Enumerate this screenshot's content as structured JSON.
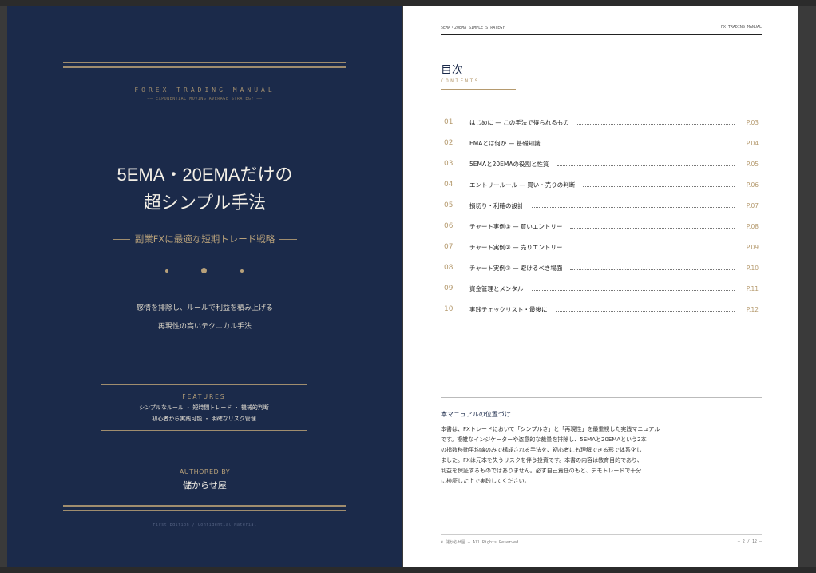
{
  "cover": {
    "kicker": "FOREX TRADING MANUAL",
    "kicker_sub": "—— EXPONENTIAL MOVING AVERAGE STRATEGY ——",
    "title_line1": "5EMA・20EMAだけの",
    "title_line2": "超シンプル手法",
    "tagline": "副業FXに最適な短期トレード戦略",
    "desc_line1": "感情を排除し、ルールで利益を積み上げる",
    "desc_line2": "再現性の高いテクニカル手法",
    "features": {
      "heading": "FEATURES",
      "line1": "シンプルなルール ・ 短時間トレード ・ 機械的判断",
      "line2": "初心者から実践可能 ・ 明確なリスク管理"
    },
    "authored_by": "AUTHORED BY",
    "author": "儲からせ屋",
    "footer": "First Edition  /  Confidential Material"
  },
  "toc_page": {
    "running_head_left": "5EMA・20EMA SIMPLE STRATEGY",
    "running_head_right": "FX TRADING MANUAL",
    "title": "目次",
    "subtitle": "CONTENTS",
    "items": [
      {
        "num": "01",
        "text": "はじめに — この手法で得られるもの",
        "page": "P.03"
      },
      {
        "num": "02",
        "text": "EMAとは何か — 基礎知識",
        "page": "P.04"
      },
      {
        "num": "03",
        "text": "5EMAと20EMAの役割と性質",
        "page": "P.05"
      },
      {
        "num": "04",
        "text": "エントリールール — 買い・売りの判断",
        "page": "P.06"
      },
      {
        "num": "05",
        "text": "損切り・利確の設計",
        "page": "P.07"
      },
      {
        "num": "06",
        "text": "チャート実例① — 買いエントリー",
        "page": "P.08"
      },
      {
        "num": "07",
        "text": "チャート実例② — 売りエントリー",
        "page": "P.09"
      },
      {
        "num": "08",
        "text": "チャート実例③ — 避けるべき場面",
        "page": "P.10"
      },
      {
        "num": "09",
        "text": "資金管理とメンタル",
        "page": "P.11"
      },
      {
        "num": "10",
        "text": "実践チェックリスト・最後に",
        "page": "P.12"
      }
    ],
    "positioning": {
      "heading": "本マニュアルの位置づけ",
      "lines": [
        "本書は、FXトレードにおいて「シンプルさ」と「再現性」を最重視した実践マニュアル",
        "です。複雑なインジケーターや恣意的な裁量を排除し、5EMAと20EMAという2本",
        "の指数移動平均線のみで構成される手法を、初心者にも理解できる形で体系化し",
        "ました。FXは元本を失うリスクを伴う投資です。本書の内容は教育目的であり、",
        "利益を保証するものではありません。必ず自己責任のもと、デモトレードで十分",
        "に検証した上で実践してください。"
      ]
    },
    "footer_left": "© 儲からせ屋 — All Rights Reserved",
    "footer_right": "— 2 / 12 —"
  }
}
